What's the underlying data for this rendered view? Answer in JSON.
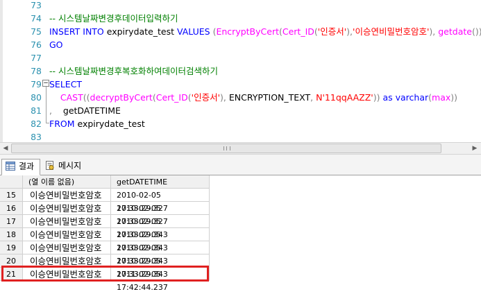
{
  "editor": {
    "lines": [
      {
        "num": "73",
        "parts": []
      },
      {
        "num": "74",
        "parts": [
          {
            "t": "-- 시스템날짜변경후데이터입력하기",
            "c": "cm"
          }
        ]
      },
      {
        "num": "75",
        "parts": [
          {
            "t": "INSERT INTO",
            "c": "kw"
          },
          {
            "t": " expirydate_test ",
            "c": "bk"
          },
          {
            "t": "VALUES",
            "c": "kw"
          },
          {
            "t": " (",
            "c": "gr"
          },
          {
            "t": "EncryptByCert",
            "c": "fn"
          },
          {
            "t": "(",
            "c": "gr"
          },
          {
            "t": "Cert_ID",
            "c": "fn"
          },
          {
            "t": "(",
            "c": "gr"
          },
          {
            "t": "'인증서'",
            "c": "str"
          },
          {
            "t": "),",
            "c": "gr"
          },
          {
            "t": "'이승연비밀번호암호'",
            "c": "str"
          },
          {
            "t": "),",
            "c": "gr"
          },
          {
            "t": " getdate",
            "c": "fn"
          },
          {
            "t": "())",
            "c": "gr"
          }
        ]
      },
      {
        "num": "76",
        "parts": [
          {
            "t": "GO",
            "c": "kw"
          }
        ]
      },
      {
        "num": "77",
        "parts": []
      },
      {
        "num": "78",
        "parts": [
          {
            "t": "-- 시스템날짜변경후복호화하여데이터검색하기",
            "c": "cm"
          }
        ]
      },
      {
        "num": "79",
        "parts": [
          {
            "t": "SELECT",
            "c": "kw"
          }
        ]
      },
      {
        "num": "80",
        "parts": [
          {
            "t": "    CAST",
            "c": "fn"
          },
          {
            "t": "((",
            "c": "gr"
          },
          {
            "t": "decryptByCert",
            "c": "fn"
          },
          {
            "t": "(",
            "c": "gr"
          },
          {
            "t": "Cert_ID",
            "c": "fn"
          },
          {
            "t": "(",
            "c": "gr"
          },
          {
            "t": "'인증서'",
            "c": "str"
          },
          {
            "t": "),",
            "c": "gr"
          },
          {
            "t": " ENCRYPTION_TEXT",
            "c": "bk"
          },
          {
            "t": ",",
            "c": "gr"
          },
          {
            "t": " N'11qqAAZZ'",
            "c": "str"
          },
          {
            "t": "))",
            "c": "gr"
          },
          {
            "t": " as",
            "c": "kw"
          },
          {
            "t": " varchar",
            "c": "kw"
          },
          {
            "t": "(",
            "c": "gr"
          },
          {
            "t": "max",
            "c": "fn"
          },
          {
            "t": "))",
            "c": "gr"
          }
        ]
      },
      {
        "num": "81",
        "parts": [
          {
            "t": ",",
            "c": "gr"
          },
          {
            "t": "    getDATETIME",
            "c": "bk"
          }
        ]
      },
      {
        "num": "82",
        "parts": [
          {
            "t": "FROM",
            "c": "kw"
          },
          {
            "t": " expirydate_test",
            "c": "bk"
          }
        ]
      },
      {
        "num": "83",
        "parts": []
      }
    ]
  },
  "tabs": {
    "results_label": "결과",
    "messages_label": "메시지"
  },
  "grid": {
    "columns": [
      "(열 이름 없음)",
      "getDATETIME"
    ],
    "rows": [
      {
        "num": "15",
        "a": "이승연비밀번호암호",
        "b": "2010-02-05 17:33:29.327"
      },
      {
        "num": "16",
        "a": "이승연비밀번호암호",
        "b": "2010-02-05 17:33:29.327"
      },
      {
        "num": "17",
        "a": "이승연비밀번호암호",
        "b": "2010-02-05 17:33:29.343"
      },
      {
        "num": "18",
        "a": "이승연비밀번호암호",
        "b": "2010-02-05 17:33:29.343"
      },
      {
        "num": "19",
        "a": "이승연비밀번호암호",
        "b": "2010-02-05 17:33:29.343"
      },
      {
        "num": "20",
        "a": "이승연비밀번호암호",
        "b": "2010-02-05 17:33:29.343"
      },
      {
        "num": "21",
        "a": "이승연비밀번호암호",
        "b": "2011-02-05 17:42:44.237"
      }
    ],
    "highlighted_row": "21",
    "highlight_color": "#e02020"
  },
  "colors": {
    "keyword": "#0000ff",
    "function": "#ff00ff",
    "string": "#ff0000",
    "comment": "#008000",
    "line_number": "#2b91af"
  }
}
